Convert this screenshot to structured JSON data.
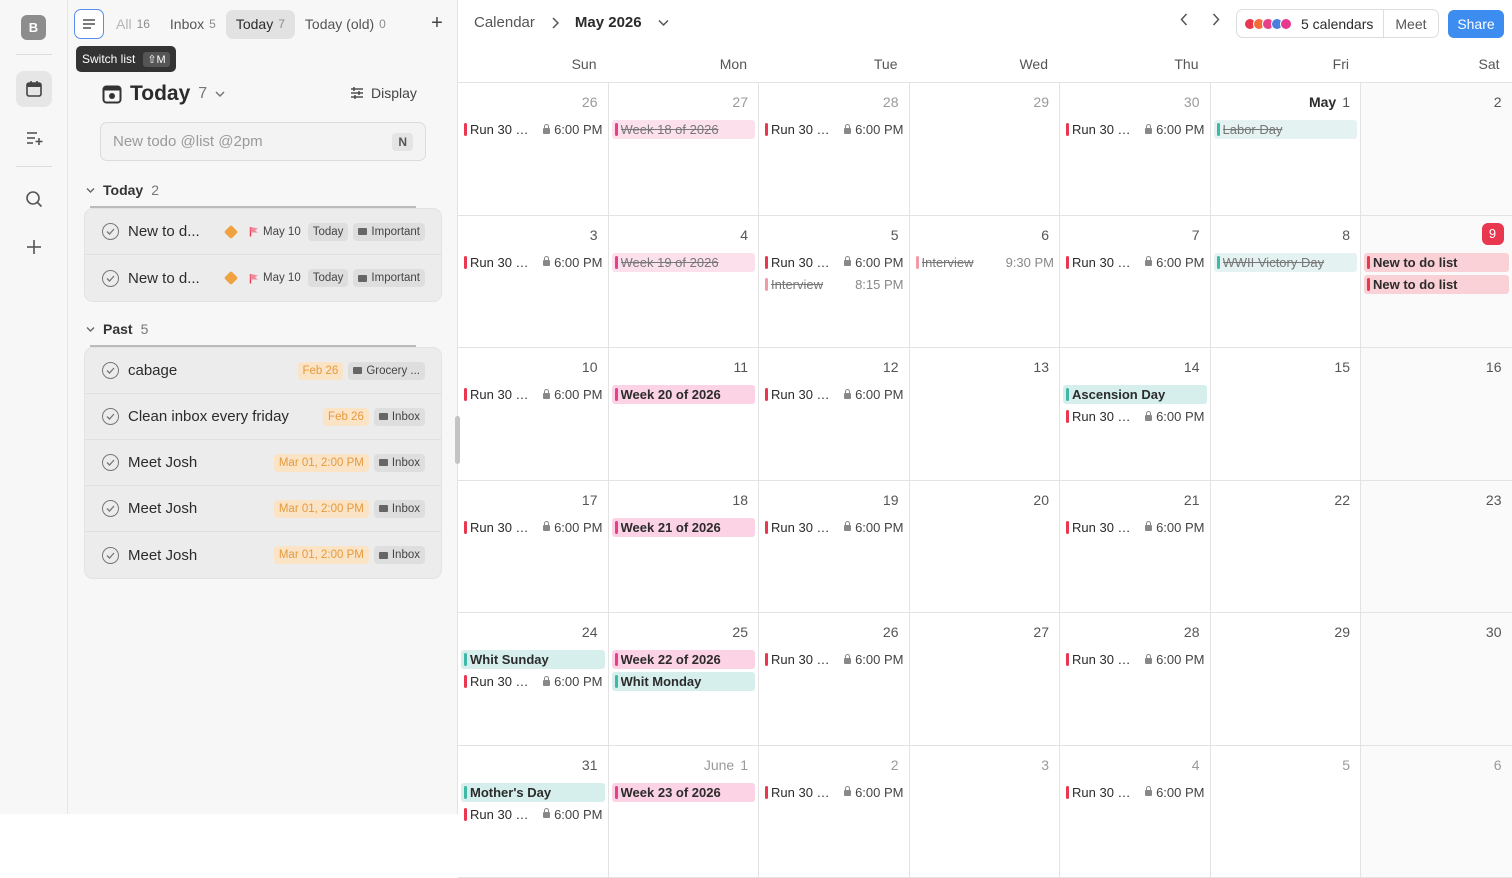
{
  "rail": {
    "avatar": "B"
  },
  "tabs": [
    {
      "label": "All",
      "count": "16"
    },
    {
      "label": "Inbox",
      "count": "5"
    },
    {
      "label": "Today",
      "count": "7"
    },
    {
      "label": "Today (old)",
      "count": "0"
    }
  ],
  "tooltip": {
    "label": "Switch list",
    "shortcut": "⇧M"
  },
  "panel": {
    "title": "Today",
    "count": "7",
    "display_label": "Display",
    "new_todo_placeholder": "New todo @list @2pm",
    "new_todo_key": "N"
  },
  "sections": {
    "today": {
      "label": "Today",
      "count": "2"
    },
    "past": {
      "label": "Past",
      "count": "5"
    }
  },
  "today_items": [
    {
      "name": "New to d...",
      "flag_date": "May 10",
      "when": "Today",
      "list": "Important"
    },
    {
      "name": "New to d...",
      "flag_date": "May 10",
      "when": "Today",
      "list": "Important"
    }
  ],
  "past_items": [
    {
      "name": "cabage",
      "date": "Feb 26",
      "list": "Grocery ..."
    },
    {
      "name": "Clean inbox every friday",
      "date": "Feb 26",
      "list": "Inbox"
    },
    {
      "name": "Meet Josh",
      "date": "Mar 01, 2:00 PM",
      "list": "Inbox"
    },
    {
      "name": "Meet Josh",
      "date": "Mar 01, 2:00 PM",
      "list": "Inbox"
    },
    {
      "name": "Meet Josh",
      "date": "Mar 01, 2:00 PM",
      "list": "Inbox"
    }
  ],
  "calendar": {
    "breadcrumb_root": "Calendar",
    "month": "May 2026",
    "calendars_label": "5 calendars",
    "calendar_colors": [
      "#e8374f",
      "#f26b3a",
      "#e83e8c",
      "#4a7fe0",
      "#e8378c"
    ],
    "meet_label": "Meet",
    "share_label": "Share",
    "weekdays": [
      "Sun",
      "Mon",
      "Tue",
      "Wed",
      "Thu",
      "Fri",
      "Sat"
    ],
    "weeks": [
      [
        {
          "day": "26",
          "muted": true,
          "events": [
            {
              "t": "red",
              "n": "Run 30 mi...",
              "time": "6:00 PM",
              "lock": true
            }
          ]
        },
        {
          "day": "27",
          "muted": true,
          "events": [
            {
              "t": "pink",
              "n": "Week 18 of 2026",
              "struck": true
            }
          ]
        },
        {
          "day": "28",
          "muted": true,
          "events": [
            {
              "t": "red",
              "n": "Run 30 mi...",
              "time": "6:00 PM",
              "lock": true
            }
          ]
        },
        {
          "day": "29",
          "muted": true,
          "events": []
        },
        {
          "day": "30",
          "muted": true,
          "events": [
            {
              "t": "red",
              "n": "Run 30 mi...",
              "time": "6:00 PM",
              "lock": true
            }
          ]
        },
        {
          "day": "1",
          "prefix": "May",
          "bold": true,
          "events": [
            {
              "t": "teal",
              "n": "Labor Day",
              "struck": true
            }
          ]
        },
        {
          "day": "2",
          "wknd": true,
          "events": []
        }
      ],
      [
        {
          "day": "3",
          "events": [
            {
              "t": "red",
              "n": "Run 30 mi...",
              "time": "6:00 PM",
              "lock": true
            }
          ]
        },
        {
          "day": "4",
          "events": [
            {
              "t": "pink",
              "n": "Week 19 of 2026",
              "struck": true
            }
          ]
        },
        {
          "day": "5",
          "events": [
            {
              "t": "red",
              "n": "Run 30 mi...",
              "time": "6:00 PM",
              "lock": true
            },
            {
              "t": "plain",
              "n": "Interview",
              "time": "8:15 PM",
              "struck": true
            }
          ]
        },
        {
          "day": "6",
          "events": [
            {
              "t": "plain",
              "n": "Interview",
              "time": "9:30 PM",
              "struck": true
            }
          ]
        },
        {
          "day": "7",
          "events": [
            {
              "t": "red",
              "n": "Run 30 mi...",
              "time": "6:00 PM",
              "lock": true
            }
          ]
        },
        {
          "day": "8",
          "events": [
            {
              "t": "teal",
              "n": "WWII Victory Day",
              "struck": true
            }
          ]
        },
        {
          "day": "9",
          "today": true,
          "wknd": true,
          "events": [
            {
              "t": "salmon",
              "n": "New to do list"
            },
            {
              "t": "salmon",
              "n": "New to do list"
            }
          ]
        }
      ],
      [
        {
          "day": "10",
          "events": [
            {
              "t": "red",
              "n": "Run 30 mi...",
              "time": "6:00 PM",
              "lock": true
            }
          ]
        },
        {
          "day": "11",
          "events": [
            {
              "t": "pink",
              "n": "Week 20 of 2026"
            }
          ]
        },
        {
          "day": "12",
          "events": [
            {
              "t": "red",
              "n": "Run 30 mi...",
              "time": "6:00 PM",
              "lock": true
            }
          ]
        },
        {
          "day": "13",
          "events": []
        },
        {
          "day": "14",
          "events": [
            {
              "t": "teal",
              "n": "Ascension Day"
            },
            {
              "t": "red",
              "n": "Run 30 mi...",
              "time": "6:00 PM",
              "lock": true
            }
          ]
        },
        {
          "day": "15",
          "events": []
        },
        {
          "day": "16",
          "wknd": true,
          "events": []
        }
      ],
      [
        {
          "day": "17",
          "events": [
            {
              "t": "red",
              "n": "Run 30 mi...",
              "time": "6:00 PM",
              "lock": true
            }
          ]
        },
        {
          "day": "18",
          "events": [
            {
              "t": "pink",
              "n": "Week 21 of 2026"
            }
          ]
        },
        {
          "day": "19",
          "events": [
            {
              "t": "red",
              "n": "Run 30 mi...",
              "time": "6:00 PM",
              "lock": true
            }
          ]
        },
        {
          "day": "20",
          "events": []
        },
        {
          "day": "21",
          "events": [
            {
              "t": "red",
              "n": "Run 30 mi...",
              "time": "6:00 PM",
              "lock": true
            }
          ]
        },
        {
          "day": "22",
          "events": []
        },
        {
          "day": "23",
          "wknd": true,
          "events": []
        }
      ],
      [
        {
          "day": "24",
          "events": [
            {
              "t": "teal",
              "n": "Whit Sunday"
            },
            {
              "t": "red",
              "n": "Run 30 mi...",
              "time": "6:00 PM",
              "lock": true
            }
          ]
        },
        {
          "day": "25",
          "events": [
            {
              "t": "pink",
              "n": "Week 22 of 2026"
            },
            {
              "t": "teal",
              "n": "Whit Monday"
            }
          ]
        },
        {
          "day": "26",
          "events": [
            {
              "t": "red",
              "n": "Run 30 mi...",
              "time": "6:00 PM",
              "lock": true
            }
          ]
        },
        {
          "day": "27",
          "events": []
        },
        {
          "day": "28",
          "events": [
            {
              "t": "red",
              "n": "Run 30 mi...",
              "time": "6:00 PM",
              "lock": true
            }
          ]
        },
        {
          "day": "29",
          "events": []
        },
        {
          "day": "30",
          "wknd": true,
          "events": []
        }
      ],
      [
        {
          "day": "31",
          "events": [
            {
              "t": "teal",
              "n": "Mother's Day"
            },
            {
              "t": "red",
              "n": "Run 30 mi...",
              "time": "6:00 PM",
              "lock": true
            }
          ]
        },
        {
          "day": "1",
          "prefix": "June",
          "muted": true,
          "events": [
            {
              "t": "pink",
              "n": "Week 23 of 2026"
            }
          ]
        },
        {
          "day": "2",
          "muted": true,
          "events": [
            {
              "t": "red",
              "n": "Run 30 mi...",
              "time": "6:00 PM",
              "lock": true
            }
          ]
        },
        {
          "day": "3",
          "muted": true,
          "events": []
        },
        {
          "day": "4",
          "muted": true,
          "events": [
            {
              "t": "red",
              "n": "Run 30 mi...",
              "time": "6:00 PM",
              "lock": true
            }
          ]
        },
        {
          "day": "5",
          "muted": true,
          "events": []
        },
        {
          "day": "6",
          "muted": true,
          "wknd": true,
          "events": []
        }
      ]
    ]
  }
}
